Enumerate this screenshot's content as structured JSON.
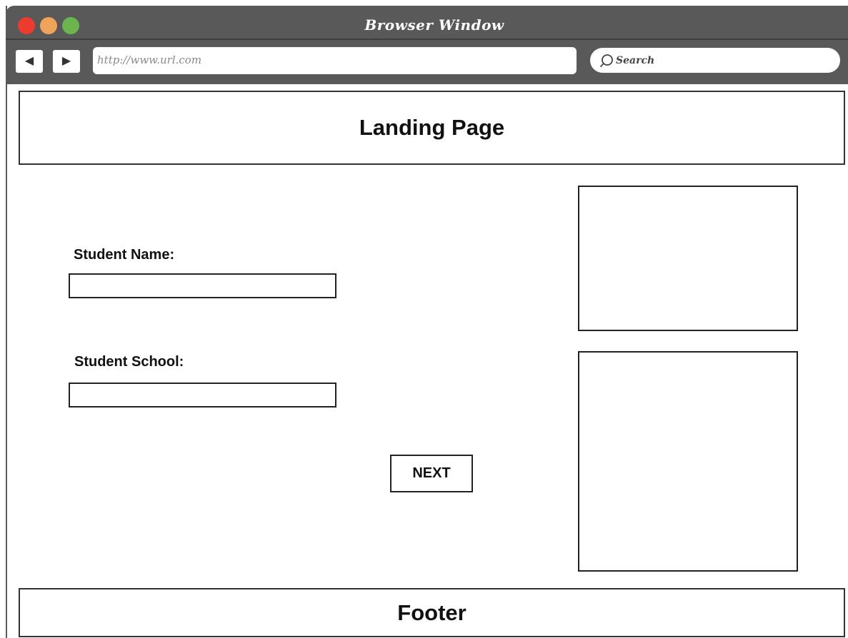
{
  "window": {
    "title": "Browser Window",
    "url": "http://www.url.com",
    "search_placeholder": "Search",
    "back_glyph": "◀",
    "forward_glyph": "▶",
    "traffic_lights": {
      "close_color": "#ec3b2f",
      "minimize_color": "#f0a35a",
      "maximize_color": "#6ab54d"
    },
    "chrome_color": "#595959"
  },
  "header": {
    "title": "Landing Page"
  },
  "form": {
    "name_label": "Student Name:",
    "name_value": "",
    "school_label": "Student School:",
    "school_value": "",
    "next_label": "NEXT"
  },
  "footer": {
    "title": "Footer"
  }
}
